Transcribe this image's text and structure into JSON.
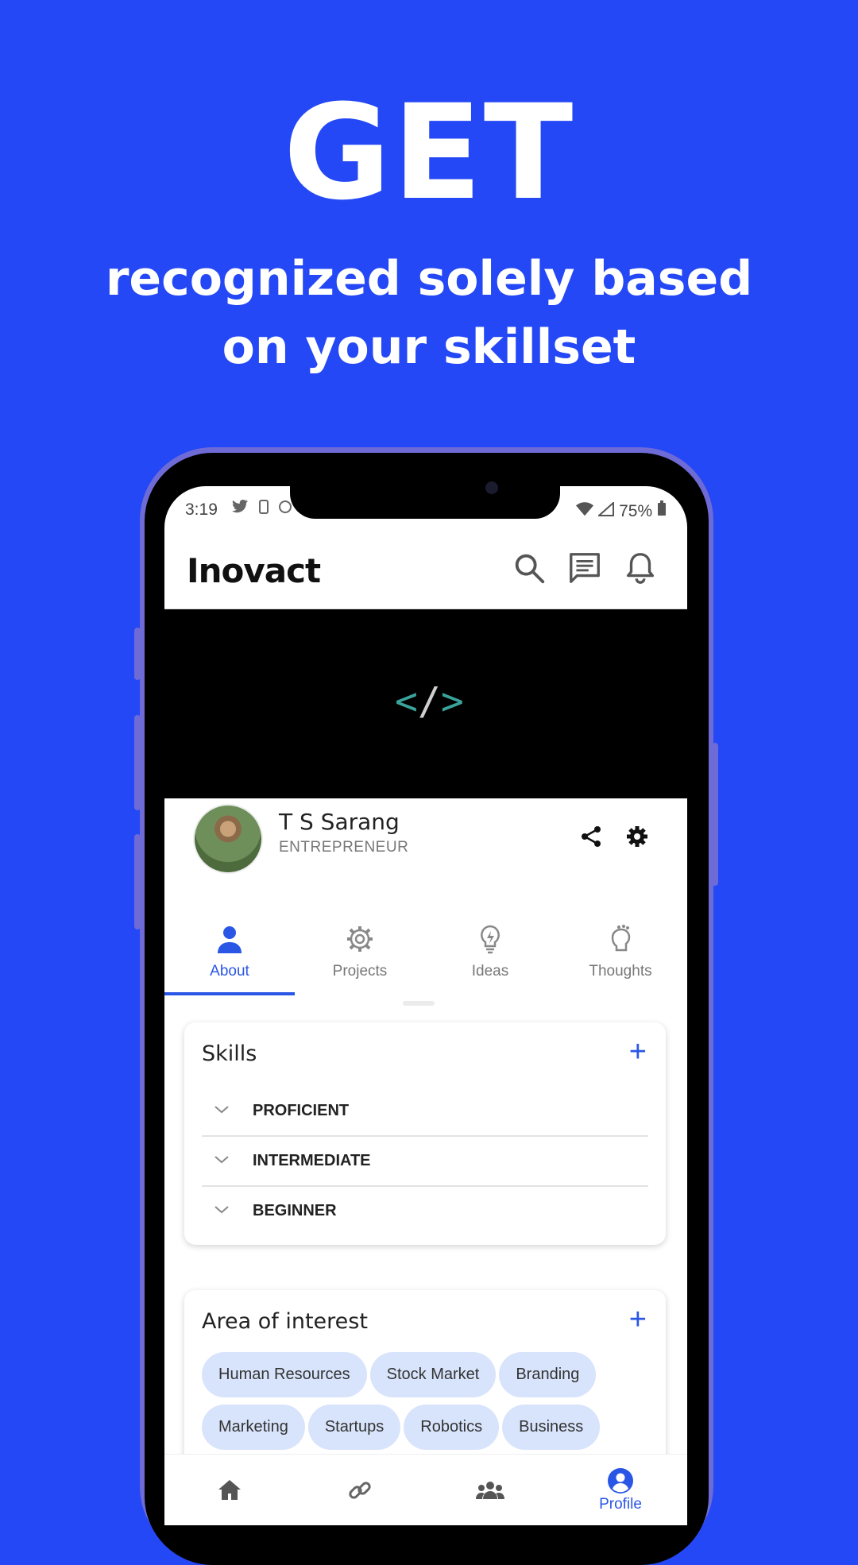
{
  "hero": {
    "headline": "GET",
    "subline_1": "recognized solely based",
    "subline_2": "on your skillset"
  },
  "status_bar": {
    "time": "3:19",
    "battery": "75%"
  },
  "app": {
    "brand": "Inovact",
    "accent_color": "#2a56e6",
    "background_color": "#2448F5"
  },
  "profile": {
    "name": "T S Sarang",
    "role": "ENTREPRENEUR"
  },
  "tabs": [
    {
      "label": "About",
      "icon": "person-icon",
      "active": true
    },
    {
      "label": "Projects",
      "icon": "gear-icon",
      "active": false
    },
    {
      "label": "Ideas",
      "icon": "lightbulb-icon",
      "active": false
    },
    {
      "label": "Thoughts",
      "icon": "thought-icon",
      "active": false
    }
  ],
  "skills": {
    "title": "Skills",
    "add": "+",
    "levels": [
      "PROFICIENT",
      "INTERMEDIATE",
      "BEGINNER"
    ]
  },
  "interests": {
    "title": "Area of interest",
    "add": "+",
    "chips": [
      "Human Resources",
      "Stock Market",
      "Branding",
      "Marketing",
      "Startups",
      "Robotics",
      "Business"
    ]
  },
  "bottom_nav": [
    {
      "icon": "home-icon",
      "active": false
    },
    {
      "icon": "link-icon",
      "active": false
    },
    {
      "icon": "group-icon",
      "active": false
    },
    {
      "icon": "profile-icon",
      "label": "Profile",
      "active": true
    }
  ]
}
